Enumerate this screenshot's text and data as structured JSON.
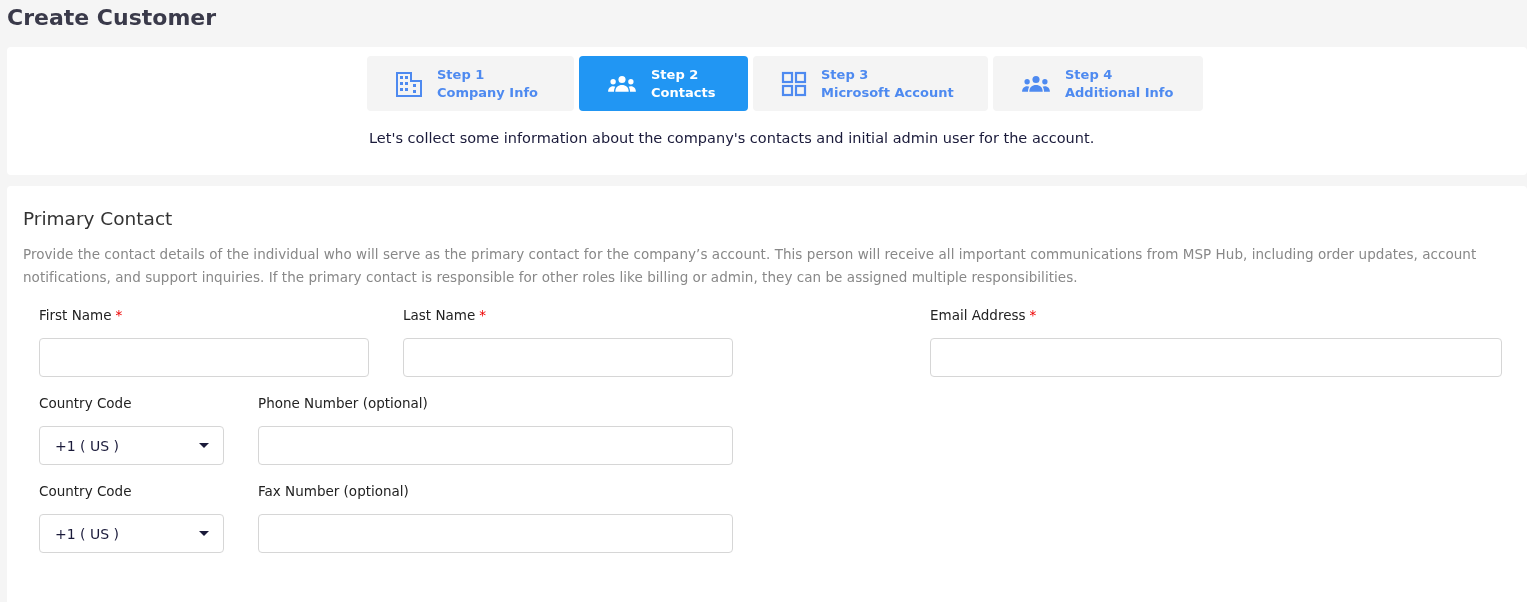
{
  "page_title": "Create Customer",
  "steps": [
    {
      "number": "Step 1",
      "label": "Company Info",
      "selected": false
    },
    {
      "number": "Step 2",
      "label": "Contacts",
      "selected": true
    },
    {
      "number": "Step 3",
      "label": "Microsoft Account",
      "selected": false
    },
    {
      "number": "Step 4",
      "label": "Additional Info",
      "selected": false
    }
  ],
  "intro": "Let's collect some information about the company's contacts and initial admin user for the account.",
  "section": {
    "title": "Primary Contact",
    "description": "Provide the contact details of the individual who will serve as the primary contact for the company’s account. This person will receive all important communications from MSP Hub, including order updates, account notifications, and support inquiries. If the primary contact is responsible for other roles like billing or admin, they can be assigned multiple responsibilities."
  },
  "form_rows": [
    [
      {
        "kind": "text",
        "label": "First Name",
        "required_mark": "*"
      },
      {
        "kind": "text",
        "label": "Last Name",
        "required_mark": "*"
      },
      {
        "kind": "text",
        "label": "Email Address",
        "required_mark": "*"
      }
    ],
    [
      {
        "kind": "select",
        "label": "Country Code",
        "value": "+1 ( US )"
      },
      {
        "kind": "text",
        "label": "Phone Number (optional)"
      }
    ],
    [
      {
        "kind": "select",
        "label": "Country Code",
        "value": "+1 ( US )"
      },
      {
        "kind": "text",
        "label": "Fax Number (optional)"
      }
    ]
  ]
}
